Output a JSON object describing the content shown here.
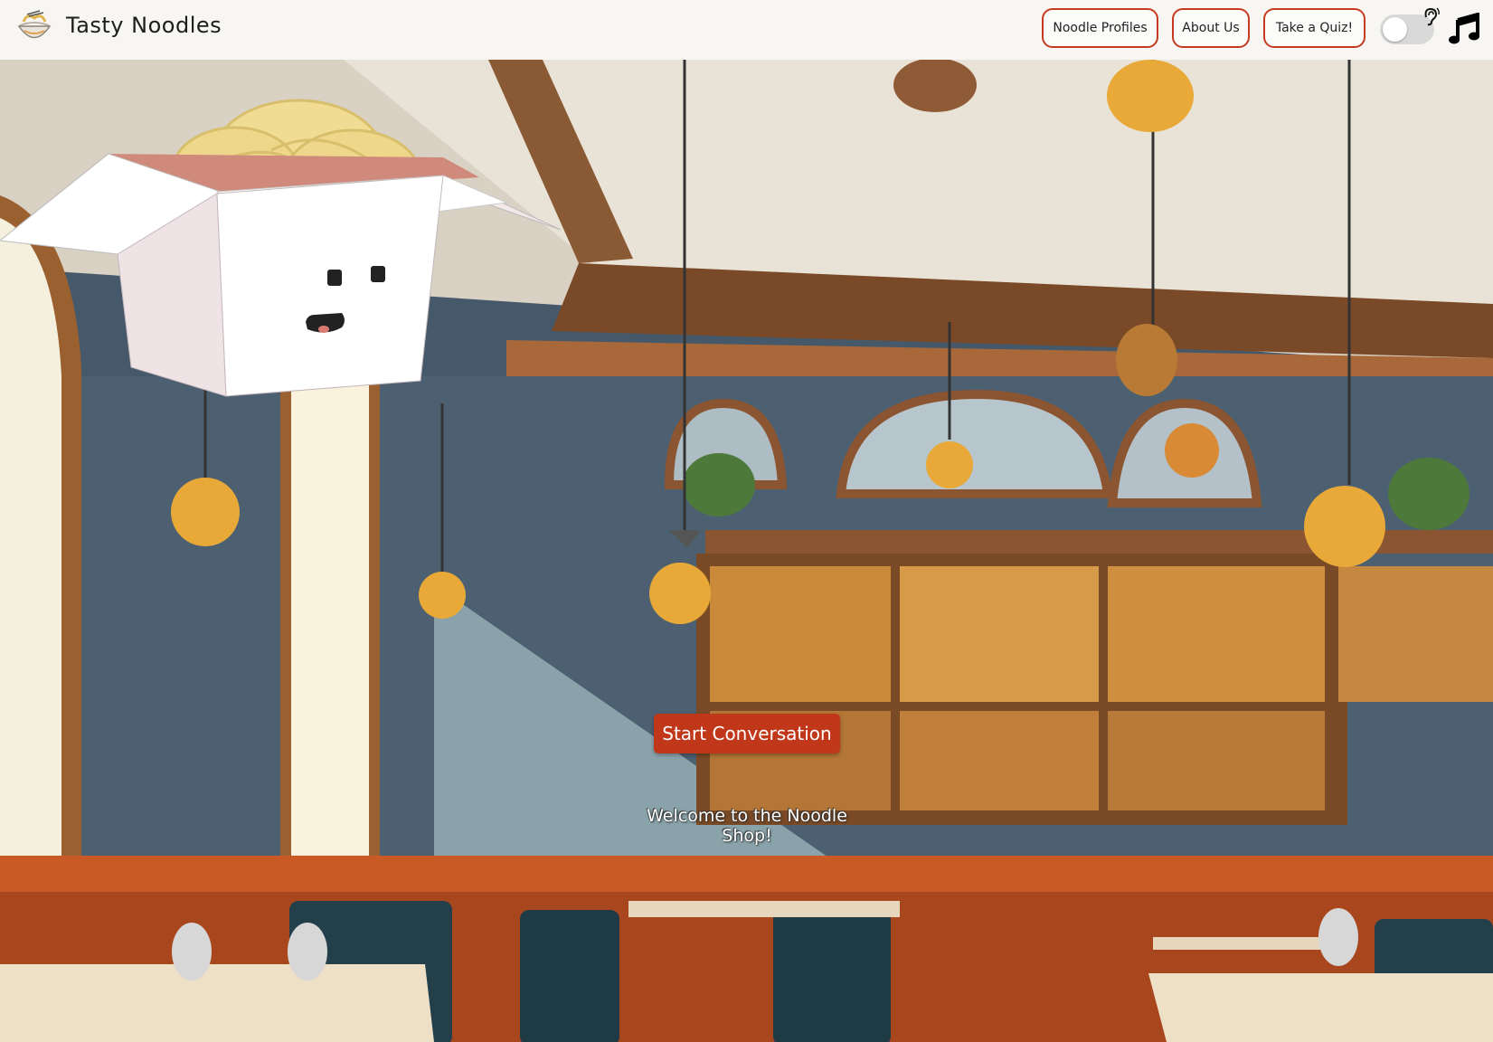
{
  "header": {
    "brand": "Tasty Noodles",
    "nav": {
      "profiles": "Noodle Profiles",
      "about": "About Us",
      "quiz": "Take a Quiz!"
    },
    "accessibility_toggle": {
      "state": "off",
      "icon": "ear-icon"
    },
    "music_icon": "music-note-icon",
    "logo_icon": "noodle-bowl-icon"
  },
  "main": {
    "start_button": "Start Conversation",
    "welcome_text": "Welcome to the Noodle Shop!",
    "mascot": "noodle-box-mascot"
  },
  "colors": {
    "accent": "#c53a20",
    "button": "#c0371a",
    "header_bg": "#f7f6f2"
  }
}
